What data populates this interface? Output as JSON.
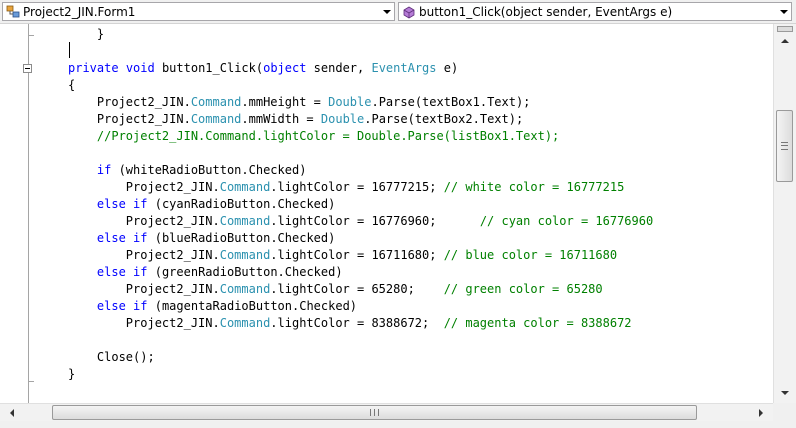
{
  "navbar": {
    "class_combo": {
      "label": "Project2_JIN.Form1",
      "icon": "class-icon"
    },
    "member_combo": {
      "label": "button1_Click(object sender, EventArgs e)",
      "icon": "method-icon"
    }
  },
  "editor": {
    "lines": [
      [
        {
          "t": "    }",
          "c": "pl"
        }
      ],
      [
        {
          "t": "",
          "c": "pl"
        }
      ],
      [
        {
          "t": "private",
          "c": "kw"
        },
        {
          "t": " ",
          "c": "pl"
        },
        {
          "t": "void",
          "c": "kw"
        },
        {
          "t": " button1_Click(",
          "c": "pl"
        },
        {
          "t": "object",
          "c": "kw"
        },
        {
          "t": " sender, ",
          "c": "pl"
        },
        {
          "t": "EventArgs",
          "c": "ty"
        },
        {
          "t": " e)",
          "c": "pl"
        }
      ],
      [
        {
          "t": "{",
          "c": "pl"
        }
      ],
      [
        {
          "t": "    Project2_JIN.",
          "c": "pl"
        },
        {
          "t": "Command",
          "c": "ty"
        },
        {
          "t": ".mmHeight = ",
          "c": "pl"
        },
        {
          "t": "Double",
          "c": "ty"
        },
        {
          "t": ".Parse(textBox1.Text);",
          "c": "pl"
        }
      ],
      [
        {
          "t": "    Project2_JIN.",
          "c": "pl"
        },
        {
          "t": "Command",
          "c": "ty"
        },
        {
          "t": ".mmWidth = ",
          "c": "pl"
        },
        {
          "t": "Double",
          "c": "ty"
        },
        {
          "t": ".Parse(textBox2.Text);",
          "c": "pl"
        }
      ],
      [
        {
          "t": "    //Project2_JIN.Command.lightColor = Double.Parse(listBox1.Text);",
          "c": "cm"
        }
      ],
      [
        {
          "t": "",
          "c": "pl"
        }
      ],
      [
        {
          "t": "    ",
          "c": "pl"
        },
        {
          "t": "if",
          "c": "kw"
        },
        {
          "t": " (whiteRadioButton.Checked)",
          "c": "pl"
        }
      ],
      [
        {
          "t": "        Project2_JIN.",
          "c": "pl"
        },
        {
          "t": "Command",
          "c": "ty"
        },
        {
          "t": ".lightColor = 16777215; ",
          "c": "pl"
        },
        {
          "t": "// white color = 16777215",
          "c": "cm"
        }
      ],
      [
        {
          "t": "    ",
          "c": "pl"
        },
        {
          "t": "else",
          "c": "kw"
        },
        {
          "t": " ",
          "c": "pl"
        },
        {
          "t": "if",
          "c": "kw"
        },
        {
          "t": " (cyanRadioButton.Checked)",
          "c": "pl"
        }
      ],
      [
        {
          "t": "        Project2_JIN.",
          "c": "pl"
        },
        {
          "t": "Command",
          "c": "ty"
        },
        {
          "t": ".lightColor = 16776960;      ",
          "c": "pl"
        },
        {
          "t": "// cyan color = 16776960",
          "c": "cm"
        }
      ],
      [
        {
          "t": "    ",
          "c": "pl"
        },
        {
          "t": "else",
          "c": "kw"
        },
        {
          "t": " ",
          "c": "pl"
        },
        {
          "t": "if",
          "c": "kw"
        },
        {
          "t": " (blueRadioButton.Checked)",
          "c": "pl"
        }
      ],
      [
        {
          "t": "        Project2_JIN.",
          "c": "pl"
        },
        {
          "t": "Command",
          "c": "ty"
        },
        {
          "t": ".lightColor = 16711680; ",
          "c": "pl"
        },
        {
          "t": "// blue color = 16711680",
          "c": "cm"
        }
      ],
      [
        {
          "t": "    ",
          "c": "pl"
        },
        {
          "t": "else",
          "c": "kw"
        },
        {
          "t": " ",
          "c": "pl"
        },
        {
          "t": "if",
          "c": "kw"
        },
        {
          "t": " (greenRadioButton.Checked)",
          "c": "pl"
        }
      ],
      [
        {
          "t": "        Project2_JIN.",
          "c": "pl"
        },
        {
          "t": "Command",
          "c": "ty"
        },
        {
          "t": ".lightColor = 65280;    ",
          "c": "pl"
        },
        {
          "t": "// green color = 65280",
          "c": "cm"
        }
      ],
      [
        {
          "t": "    ",
          "c": "pl"
        },
        {
          "t": "else",
          "c": "kw"
        },
        {
          "t": " ",
          "c": "pl"
        },
        {
          "t": "if",
          "c": "kw"
        },
        {
          "t": " (magentaRadioButton.Checked)",
          "c": "pl"
        }
      ],
      [
        {
          "t": "        Project2_JIN.",
          "c": "pl"
        },
        {
          "t": "Command",
          "c": "ty"
        },
        {
          "t": ".lightColor = 8388672;  ",
          "c": "pl"
        },
        {
          "t": "// magenta color = 8388672",
          "c": "cm"
        }
      ],
      [
        {
          "t": "",
          "c": "pl"
        }
      ],
      [
        {
          "t": "    Close();",
          "c": "pl"
        }
      ],
      [
        {
          "t": "}",
          "c": "pl"
        }
      ]
    ]
  },
  "colors": {
    "keyword": "#0000ff",
    "type": "#2b91af",
    "comment": "#008000",
    "plain": "#000000"
  }
}
